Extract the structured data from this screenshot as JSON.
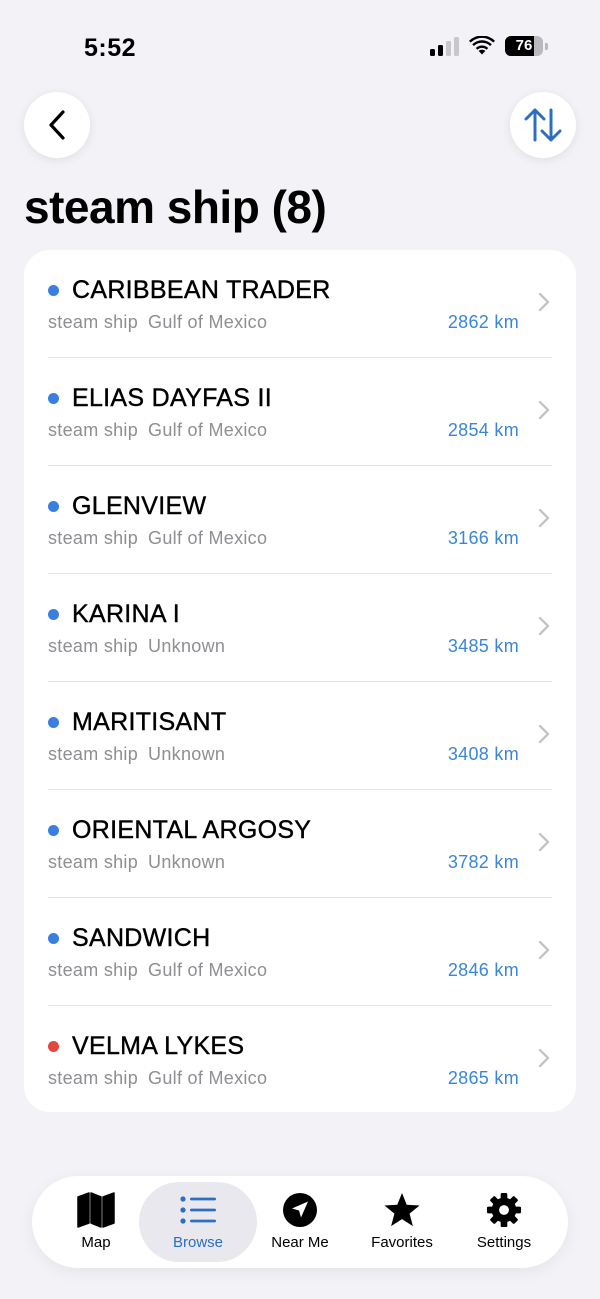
{
  "status": {
    "time": "5:52",
    "battery": "76",
    "battery_level": 0.76
  },
  "header": {
    "title": "steam ship (8)"
  },
  "ships": [
    {
      "name": "CARIBBEAN TRADER",
      "type": "steam ship",
      "location": "Gulf of Mexico",
      "distance": "2862 km",
      "dot_color": "#3a7fe0"
    },
    {
      "name": "ELIAS DAYFAS II",
      "type": "steam ship",
      "location": "Gulf of Mexico",
      "distance": "2854 km",
      "dot_color": "#3a7fe0"
    },
    {
      "name": "GLENVIEW",
      "type": "steam ship",
      "location": "Gulf of Mexico",
      "distance": "3166 km",
      "dot_color": "#3a7fe0"
    },
    {
      "name": "KARINA I",
      "type": "steam ship",
      "location": "Unknown",
      "distance": "3485 km",
      "dot_color": "#3a7fe0"
    },
    {
      "name": "MARITISANT",
      "type": "steam ship",
      "location": "Unknown",
      "distance": "3408 km",
      "dot_color": "#3a7fe0"
    },
    {
      "name": "ORIENTAL ARGOSY",
      "type": "steam ship",
      "location": "Unknown",
      "distance": "3782 km",
      "dot_color": "#3a7fe0"
    },
    {
      "name": "SANDWICH",
      "type": "steam ship",
      "location": "Gulf of Mexico",
      "distance": "2846 km",
      "dot_color": "#3a7fe0"
    },
    {
      "name": "VELMA LYKES",
      "type": "steam ship",
      "location": "Gulf of Mexico",
      "distance": "2865 km",
      "dot_color": "#e0483e"
    }
  ],
  "tabs": [
    {
      "label": "Map",
      "icon": "map-icon",
      "active": false
    },
    {
      "label": "Browse",
      "icon": "list-icon",
      "active": true
    },
    {
      "label": "Near Me",
      "icon": "location-arrow-icon",
      "active": false
    },
    {
      "label": "Favorites",
      "icon": "star-icon",
      "active": false
    },
    {
      "label": "Settings",
      "icon": "gear-icon",
      "active": false
    }
  ],
  "colors": {
    "accent": "#2c6fc0",
    "distance": "#3a86d8",
    "background": "#f2f2f7"
  }
}
